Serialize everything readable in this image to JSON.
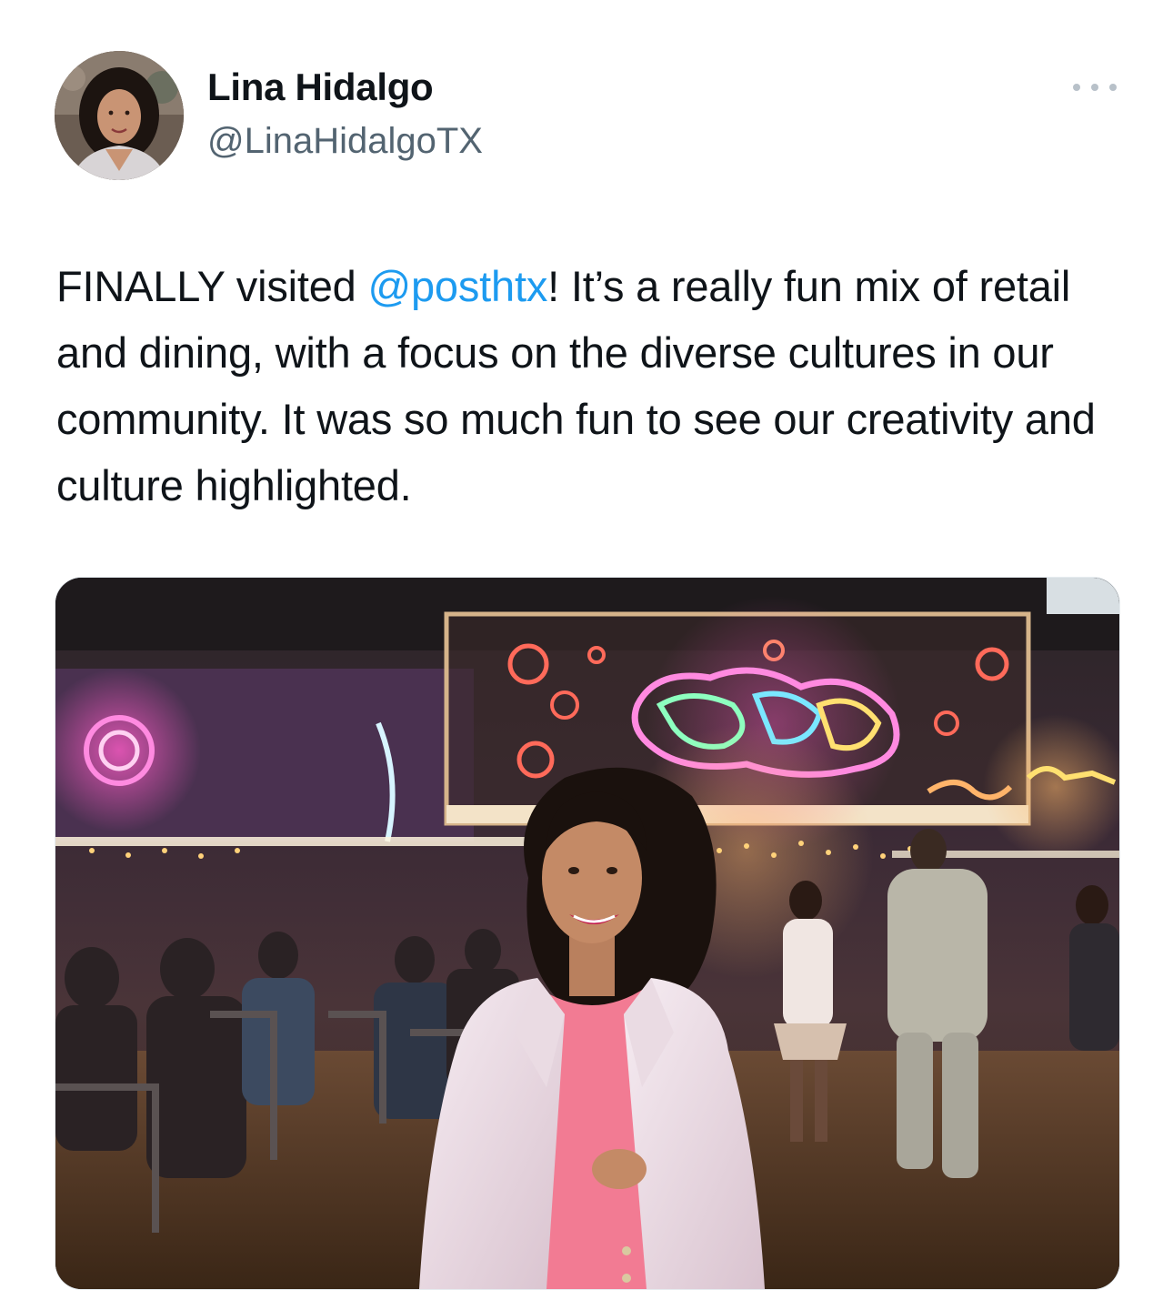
{
  "author": {
    "name": "Lina Hidalgo",
    "handle": "@LinaHidalgoTX"
  },
  "tweet": {
    "text_before_mention": "FINALLY visited ",
    "mention": "@posthtx",
    "text_after_mention": "! It’s a really fun mix of retail and dining, with a focus on the diverse cultures in our community. It was so much fun to see our creativity and culture highlighted."
  },
  "media": {
    "alt": "",
    "colors": {
      "neon_pink": "#ff5cc8",
      "neon_green": "#7dffb0",
      "neon_yellow": "#ffd24a",
      "neon_orange": "#ff7a4a",
      "blazer": "#f1e2ec",
      "top": "#f27b93"
    }
  },
  "colors": {
    "text": "#0f1419",
    "secondary_text": "#536471",
    "link": "#1d9bf0"
  },
  "icons": {
    "more": "more-horizontal-icon"
  }
}
